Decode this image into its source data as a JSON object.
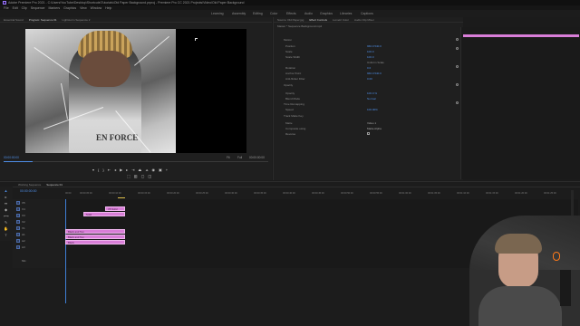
{
  "title_bar": {
    "text": "Adobe Premiere Pro 2021 - C:\\Users\\YouTube\\Desktop\\Shortcuts\\Tutorials\\Old Paper Background.prproj - Premiere Pro CC 2021 Projects\\Video\\Old Paper Background"
  },
  "menu": [
    "File",
    "Edit",
    "Clip",
    "Sequence",
    "Markers",
    "Graphics",
    "View",
    "Window",
    "Help"
  ],
  "workspaces": [
    "Learning",
    "Assembly",
    "Editing",
    "Color",
    "Effects",
    "Audio",
    "Graphics",
    "Libraries",
    "Captions"
  ],
  "source_tabs": [
    "Essential Sound",
    "Program: Sequence 01",
    "Lightstorm Sequence 2"
  ],
  "program": {
    "timecode_left": "00:00:00:00",
    "fit": "Fit",
    "quality": "Full",
    "timecode_right": "00:00:00:00",
    "shirt_text": "EN FORCE"
  },
  "effect_controls": {
    "tabs": [
      "Source: Old Paper.jpg",
      "Effect Controls",
      "Lumetri Color",
      "Audio Clip Mixer"
    ],
    "clip_name": "Master * Sequence Background.mp4",
    "properties": [
      {
        "name": "Motion",
        "value": ""
      },
      {
        "name": "Position",
        "value": "960.0   540.0"
      },
      {
        "name": "Scale",
        "value": "100.0"
      },
      {
        "name": "Scale Width",
        "value": "100.0"
      },
      {
        "name": "",
        "value": "Uniform Scale"
      },
      {
        "name": "Rotation",
        "value": "0.0"
      },
      {
        "name": "Anchor Point",
        "value": "960.0   540.0"
      },
      {
        "name": "Anti-flicker Filter",
        "value": "0.00"
      },
      {
        "name": "Opacity",
        "value": ""
      },
      {
        "name": "Opacity",
        "value": "100.0 %"
      },
      {
        "name": "Blend Mode",
        "value": "Normal"
      },
      {
        "name": "Time Remapping",
        "value": ""
      },
      {
        "name": "Speed",
        "value": "100.00%"
      },
      {
        "name": "Track Matte Key",
        "value": ""
      },
      {
        "name": "Matte",
        "value": "Video 1"
      },
      {
        "name": "Composite using",
        "value": "Matte Alpha"
      },
      {
        "name": "Reverse",
        "value": ""
      }
    ]
  },
  "timeline": {
    "tabs": [
      "Working Sequence",
      "Sequence 01"
    ],
    "timecode": "00:00:00:00",
    "ruler": [
      "00:00",
      "00:00:05:00",
      "00:00:10:00",
      "00:00:15:00",
      "00:00:20:00",
      "00:00:25:00",
      "00:00:30:00",
      "00:00:35:00",
      "00:00:40:00",
      "00:00:45:00",
      "00:00:50:00",
      "00:00:55:00",
      "00:01:00:00",
      "00:01:05:00",
      "00:01:10:00",
      "00:01:15:00",
      "00:01:20:00",
      "00:01:25:00"
    ],
    "tracks": [
      "V5",
      "V4",
      "V3",
      "V2",
      "V1",
      "A1",
      "A2",
      "A3",
      "Mix"
    ],
    "clips": [
      {
        "label": "V5 Solid"
      },
      {
        "label": "Solid"
      },
      {
        "label": "Black and Tag"
      },
      {
        "label": "Black and Tag"
      },
      {
        "label": "Black"
      }
    ]
  },
  "colors": {
    "accent_blue": "#4f8fe8",
    "clip_pink": "#d97ed8",
    "playhead": "#3f7fd6"
  }
}
